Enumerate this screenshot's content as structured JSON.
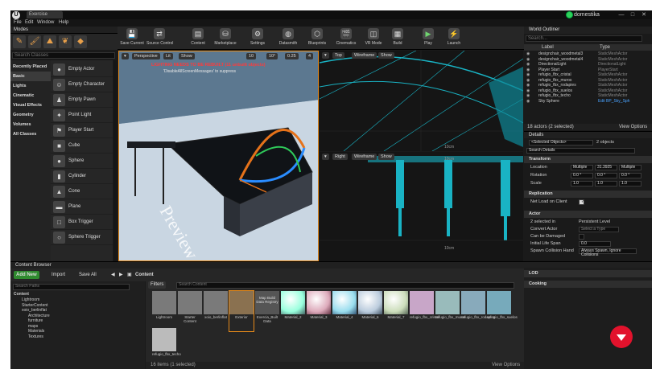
{
  "titlebar": {
    "tab": "Exercise",
    "user": "domestika",
    "min": "—",
    "max": "□",
    "close": "✕"
  },
  "menu": [
    "File",
    "Edit",
    "Window",
    "Help"
  ],
  "modes": {
    "label": "Modes",
    "search_placeholder": "Search Classes"
  },
  "categories": [
    "Recently Placed",
    "Basic",
    "Lights",
    "Cinematic",
    "Visual Effects",
    "Geometry",
    "Volumes",
    "All Classes"
  ],
  "place_items": [
    "Empty Actor",
    "Empty Character",
    "Empty Pawn",
    "Point Light",
    "Player Start",
    "Cube",
    "Sphere",
    "Cylinder",
    "Cone",
    "Plane",
    "Box Trigger",
    "Sphere Trigger"
  ],
  "toolbar": [
    "Save Current",
    "Source Control",
    "Content",
    "Marketplace",
    "Settings",
    "Datasmith",
    "Blueprints",
    "Cinematics",
    "VR Mode",
    "Build",
    "Play",
    "Launch"
  ],
  "viewport_persp": {
    "mode": "Perspective",
    "lit": "Lit",
    "show": "Show",
    "grid": "10",
    "rot": "10°",
    "scale": "0.25",
    "cam": "4",
    "warning": "LIGHTING NEEDS TO BE REBUILT (11 unbuilt objects)",
    "hint": "'DisableAllScreenMessages' to suppress",
    "watermark": "Preview"
  },
  "viewport_top": {
    "mode": "Top",
    "view": "Wireframe",
    "show": "Show",
    "scale": "10cm"
  },
  "viewport_right": {
    "mode": "Right",
    "view": "Wireframe",
    "show": "Show",
    "scale_top": "10cm",
    "scale_bot": "10cm"
  },
  "outliner": {
    "title": "World Outliner",
    "search_placeholder": "Search...",
    "col_label": "Label",
    "col_type": "Type",
    "rows": [
      {
        "label": "designchair_woodmetal3",
        "type": "StaticMeshActor"
      },
      {
        "label": "designchair_woodmetal4",
        "type": "StaticMeshActor"
      },
      {
        "label": "DirectionalLight",
        "type": "DirectionalLight"
      },
      {
        "label": "Player Start",
        "type": "PlayerStart"
      },
      {
        "label": "refugio_fbx_cristal",
        "type": "StaticMeshActor"
      },
      {
        "label": "refugio_fbx_muros",
        "type": "StaticMeshActor"
      },
      {
        "label": "refugio_fbx_rodapies",
        "type": "StaticMeshActor"
      },
      {
        "label": "refugio_fbx_suelos",
        "type": "StaticMeshActor"
      },
      {
        "label": "refugio_fbx_techo",
        "type": "StaticMeshActor"
      },
      {
        "label": "Sky Sphere",
        "type": "Edit BP_Sky_Sph"
      }
    ],
    "footer": "18 actors (2 selected)",
    "view_options": "View Options"
  },
  "details": {
    "title": "Details",
    "selected": "<Selected Objects>",
    "count": "2 objects",
    "search_placeholder": "Search Details",
    "transform": "Transform",
    "location": "Location",
    "rotation": "Rotation",
    "scale": "Scale",
    "loc_x": "Multiple",
    "loc_y": "31.3925",
    "loc_z": "Multiple",
    "rot_x": "0.0 °",
    "rot_y": "0.0 °",
    "rot_z": "0.0 °",
    "scl_x": "1.0",
    "scl_y": "1.0",
    "scl_z": "1.0",
    "replication": "Replication",
    "net_load": "Net Load on Client",
    "actor": "Actor",
    "selected_in": "2 selected in",
    "level": "Persistent Level",
    "convert_actor": "Convert Actor",
    "select_type": "Select a Type",
    "can_be_damaged": "Can be Damaged",
    "initial_life_span": "Initial Life Span",
    "life_span_val": "0.0",
    "spawn_collision": "Spawn Collision Hand",
    "spawn_val": "Always Spawn, Ignore Collisions",
    "lod": "LOD",
    "cooking": "Cooking"
  },
  "content_browser": {
    "title": "Content Browser",
    "add_new": "Add New",
    "import": "Import",
    "save_all": "Save All",
    "path": "Content",
    "search_paths": "Search Paths",
    "filters": "Filters",
    "search_content": "Search Content",
    "tree": [
      "Content",
      "Lightroom",
      "StarterContent",
      "xoio_berlinflat",
      "Architecture",
      "furniture",
      "maps",
      "Materials",
      "Textures"
    ],
    "assets": [
      "Lightroom",
      "Starter Content",
      "xoio_berlinflat",
      "Exterior",
      "Map Build Data Registry",
      "Material_2",
      "Material_3",
      "Material_4",
      "Material_6",
      "Material_7",
      "refugio_fbx_cristal",
      "refugio_fbx_muros",
      "refugio_fbx_rodapies",
      "refugio_fbx_suelos",
      "refugio_fbx_techo"
    ],
    "thumb_label": "Exercia_Built Data",
    "footer": "16 items (1 selected)",
    "view_options": "View Options"
  }
}
